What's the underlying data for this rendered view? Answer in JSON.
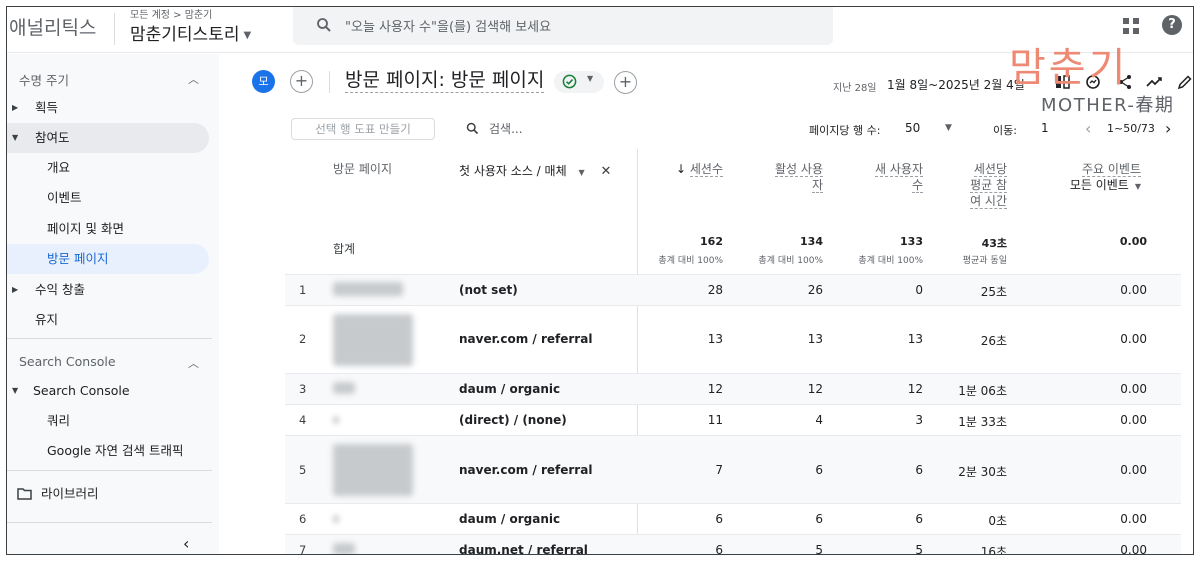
{
  "topbar": {
    "brand": "애널리틱스",
    "breadcrumb": "모든 계정 > 맘춘기",
    "property": "맘춘기티스토리",
    "search_placeholder": "\"오늘 사용자 수\"을(를) 검색해 보세요"
  },
  "sidebar": {
    "lifecycle_header": "수명 주기",
    "items": [
      {
        "label": "획득"
      },
      {
        "label": "참여도"
      },
      {
        "label": "개요"
      },
      {
        "label": "이벤트"
      },
      {
        "label": "페이지 및 화면"
      },
      {
        "label": "방문 페이지"
      },
      {
        "label": "수익 창출"
      },
      {
        "label": "유지"
      }
    ],
    "search_console_header": "Search Console",
    "search_console_group": "Search Console",
    "search_console_items": [
      {
        "label": "쿼리"
      },
      {
        "label": "Google 자연 검색 트래픽"
      }
    ],
    "library": "라이브러리"
  },
  "header": {
    "avatar": "모",
    "title": "방문 페이지: 방문 페이지",
    "date_label": "지난 28일",
    "date_range": "1월 8일~2025년 2월 4일"
  },
  "watermark": {
    "main": "맘춘기",
    "sub": "MOTHER-春期"
  },
  "toolbar": {
    "segment_button": "선택 행 도표 만들기",
    "search_placeholder": "검색...",
    "rows_per_page_label": "페이지당 행 수:",
    "rows_per_page": "50",
    "goto_label": "이동:",
    "goto_value": "1",
    "page_range": "1~50/73"
  },
  "table": {
    "col_page": "방문 페이지",
    "col_source": "첫 사용자 소스 / 매체",
    "col_sessions": "세션수",
    "col_active_users_1": "활성 사용",
    "col_active_users_2": "자",
    "col_new_users_1": "새 사용자",
    "col_new_users_2": "수",
    "col_avg_time_1": "세션당",
    "col_avg_time_2": "평균 참",
    "col_avg_time_3": "여 시간",
    "col_key_events": "주요 이벤트",
    "col_key_events_sub": "모든 이벤트",
    "totals_label": "합계",
    "totals": {
      "sessions": "162",
      "sessions_sub": "총계 대비 100%",
      "active": "134",
      "active_sub": "총계 대비 100%",
      "new": "133",
      "new_sub": "총계 대비 100%",
      "avg": "43초",
      "avg_sub": "평균과 동일",
      "key": "0.00"
    },
    "rows": [
      {
        "idx": "1",
        "source": "(not set)",
        "sessions": "28",
        "active": "26",
        "new": "0",
        "avg": "25초",
        "key": "0.00"
      },
      {
        "idx": "2",
        "source": "naver.com / referral",
        "sessions": "13",
        "active": "13",
        "new": "13",
        "avg": "26초",
        "key": "0.00"
      },
      {
        "idx": "3",
        "source": "daum / organic",
        "sessions": "12",
        "active": "12",
        "new": "12",
        "avg": "1분 06초",
        "key": "0.00"
      },
      {
        "idx": "4",
        "source": "(direct) / (none)",
        "sessions": "11",
        "active": "4",
        "new": "3",
        "avg": "1분 33초",
        "key": "0.00"
      },
      {
        "idx": "5",
        "source": "naver.com / referral",
        "sessions": "7",
        "active": "6",
        "new": "6",
        "avg": "2분 30초",
        "key": "0.00"
      },
      {
        "idx": "6",
        "source": "daum / organic",
        "sessions": "6",
        "active": "6",
        "new": "6",
        "avg": "0초",
        "key": "0.00"
      },
      {
        "idx": "7",
        "source": "daum.net / referral",
        "sessions": "6",
        "active": "5",
        "new": "5",
        "avg": "16초",
        "key": "0.00"
      }
    ]
  },
  "colors": {
    "accent": "#1a73e8",
    "selected_bg": "#e8f0fe",
    "selected_text": "#1967d2",
    "success": "#188038",
    "watermark": "#ee8a74"
  }
}
